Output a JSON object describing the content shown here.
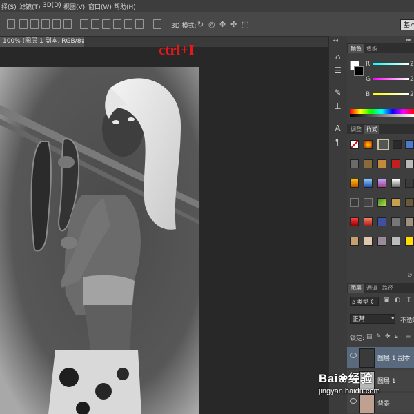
{
  "menu": {
    "items": [
      "择(S)",
      "滤镜(T)",
      "3D(D)",
      "视图(V)",
      "窗口(W)",
      "帮助(H)"
    ]
  },
  "options_bar": {
    "mode_3d_label": "3D 模式:",
    "workspace_button": "基本"
  },
  "document": {
    "tab_title": "100% (图层 1 副本, RGB/8#) *",
    "close_symbol": "×"
  },
  "annotation": {
    "text": "ctrl+I",
    "color": "#e0191d"
  },
  "color_panel": {
    "tabs": [
      "颜色",
      "色板"
    ],
    "channels": [
      {
        "label": "R",
        "value": "2"
      },
      {
        "label": "G",
        "value": "2"
      },
      {
        "label": "B",
        "value": "2"
      }
    ]
  },
  "styles_panel": {
    "tabs": [
      "调整",
      "样式"
    ]
  },
  "layers_panel": {
    "tabs": [
      "图层",
      "通道",
      "路径"
    ],
    "filter_label": "ρ 类型",
    "blend_mode": "正常",
    "opacity_label": "不透明",
    "lock_label": "锁定:",
    "layers": [
      {
        "name": "图层 1 副本",
        "selected": true
      },
      {
        "name": "图层 1",
        "selected": false
      },
      {
        "name": "背景",
        "selected": false
      }
    ]
  },
  "watermark": {
    "brand": "Bai❀经验",
    "url": "jingyan.baidu.com"
  },
  "icons": {
    "palette_bar": [
      "palette-icon",
      "brush-icon",
      "text-icon",
      "paragraph-icon",
      "clone-stamp-icon"
    ]
  }
}
